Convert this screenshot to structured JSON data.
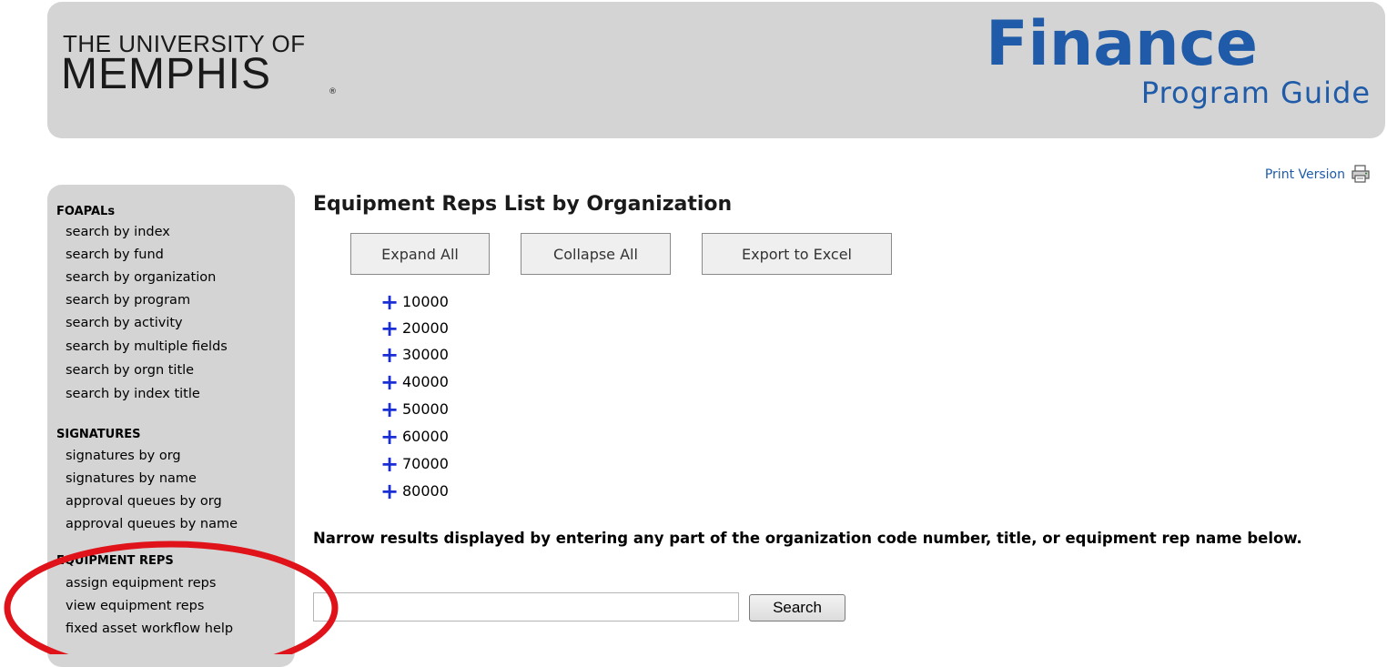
{
  "header": {
    "university_top": "THE UNIVERSITY OF",
    "university_name": "MEMPHIS",
    "university_mark": "®",
    "app_title": "Finance",
    "app_subtitle": "Program Guide"
  },
  "print_version": {
    "label": "Print Version",
    "icon": "printer-icon"
  },
  "sidebar": {
    "sections": [
      {
        "title": "FOAPALs",
        "items": [
          "search by index",
          "search by fund",
          "search by organization",
          "search by program",
          "search by activity",
          "search by multiple fields",
          "search by orgn title",
          "search by index title"
        ]
      },
      {
        "title": "SIGNATURES",
        "items": [
          "signatures by org",
          "signatures by name",
          "approval queues by org",
          "approval queues by name"
        ]
      },
      {
        "title": "EQUIPMENT REPS",
        "items": [
          "assign equipment reps",
          "view equipment reps",
          "fixed asset workflow help"
        ]
      }
    ]
  },
  "main": {
    "title": "Equipment Reps List by Organization",
    "buttons": {
      "expand_all": "Expand All",
      "collapse_all": "Collapse All",
      "export": "Export to Excel"
    },
    "tree_icon": "plus-icon",
    "tree": [
      {
        "plus": "+",
        "code": "10000"
      },
      {
        "plus": "+",
        "code": "20000"
      },
      {
        "plus": "+",
        "code": "30000"
      },
      {
        "plus": "+",
        "code": "40000"
      },
      {
        "plus": "+",
        "code": "50000"
      },
      {
        "plus": "+",
        "code": "60000"
      },
      {
        "plus": "+",
        "code": "70000"
      },
      {
        "plus": "+",
        "code": "80000"
      }
    ],
    "instructions": "Narrow results displayed by entering any part of the organization code number, title, or equipment rep name below.",
    "search": {
      "value": "",
      "placeholder": "",
      "button_label": "Search"
    }
  },
  "colors": {
    "brand_blue": "#1f5ba8",
    "header_bg": "#d4d4d4",
    "annotation_red": "#e0121a",
    "tree_plus": "#1a2ed6"
  }
}
